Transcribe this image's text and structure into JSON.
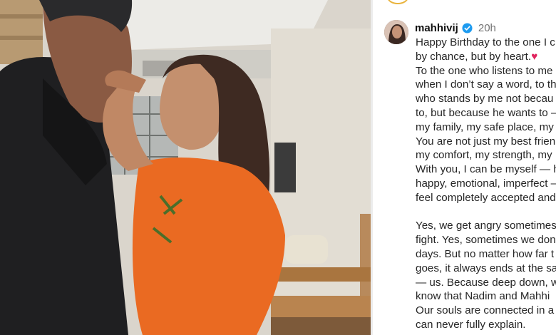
{
  "post": {
    "username": "mahhivij",
    "timestamp": "20h",
    "caption_lines_1": [
      "Happy Birthday to the one I c",
      "by chance, but by heart.",
      "To the one who listens to me",
      "when I don’t say a word, to th",
      "who stands by me not becau",
      "to, but because he wants to –",
      "my family, my safe place, my",
      "You are not just my best frien",
      "my comfort, my strength, my",
      "With you, I can be myself — h",
      "happy, emotional, imperfect –",
      "feel completely accepted and"
    ],
    "heart_emoji": "♥",
    "caption_lines_2": [
      "Yes, we get angry sometimes",
      "fight. Yes, sometimes we don",
      "days. But no matter how far t",
      "goes, it always ends at the sa",
      "— us. Because deep down, w",
      "know that Nadim and Mahhi",
      "Our souls are connected in a",
      "can never fully explain."
    ]
  },
  "colors": {
    "verified": "#1d9bf0",
    "heart": "#e0245e",
    "text": "#262626",
    "muted": "#737373"
  },
  "icons": {
    "verified": "verified-badge-icon"
  }
}
